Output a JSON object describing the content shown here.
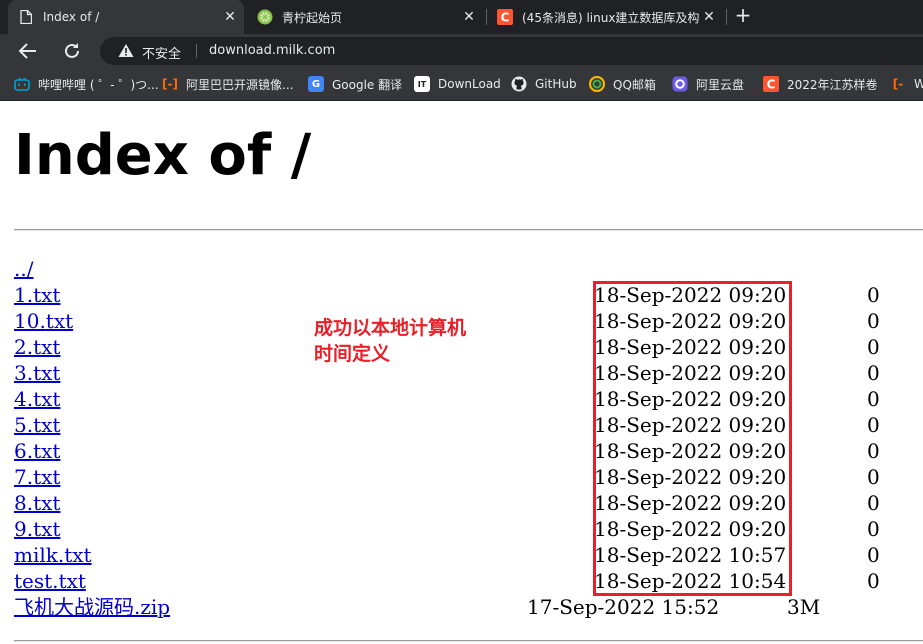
{
  "tabs": [
    {
      "title": "Index of /",
      "icon": "document-icon",
      "active": true
    },
    {
      "title": "青柠起始页",
      "icon": "lime-icon",
      "active": false
    },
    {
      "title": "(45条消息) linux建立数据库及构",
      "icon": "csdn-icon",
      "active": false
    }
  ],
  "toolbar": {
    "security_label": "不安全",
    "url": "download.milk.com"
  },
  "bookmarks": [
    {
      "label": "哔哩哔哩 ( ゜- ゜)つ...",
      "icon": "bilibili-icon",
      "color": "#00a1d6"
    },
    {
      "label": "阿里巴巴开源镜像...",
      "icon": "alibaba-icon",
      "color": "#ff6a00"
    },
    {
      "label": "Google 翻译",
      "icon": "google-translate-icon",
      "color": "#4285f4"
    },
    {
      "label": "DownLoad",
      "icon": "download-site-icon",
      "color": "#ffffff"
    },
    {
      "label": "GitHub",
      "icon": "github-icon",
      "color": "#ffffff"
    },
    {
      "label": "QQ邮箱",
      "icon": "qq-mail-icon",
      "color": "#f5b400"
    },
    {
      "label": "阿里云盘",
      "icon": "aliyun-drive-icon",
      "color": "#6c5ce7"
    },
    {
      "label": "2022年江苏样卷",
      "icon": "csdn-icon",
      "color": "#fc5531"
    },
    {
      "label": "W",
      "icon": "orange-bracket-icon",
      "color": "#ff6a00"
    }
  ],
  "page": {
    "title": "Index of /",
    "parent_link": "../",
    "entries": [
      {
        "name": "1.txt",
        "date": "18-Sep-2022 09:20",
        "size": "0"
      },
      {
        "name": "10.txt",
        "date": "18-Sep-2022 09:20",
        "size": "0"
      },
      {
        "name": "2.txt",
        "date": "18-Sep-2022 09:20",
        "size": "0"
      },
      {
        "name": "3.txt",
        "date": "18-Sep-2022 09:20",
        "size": "0"
      },
      {
        "name": "4.txt",
        "date": "18-Sep-2022 09:20",
        "size": "0"
      },
      {
        "name": "5.txt",
        "date": "18-Sep-2022 09:20",
        "size": "0"
      },
      {
        "name": "6.txt",
        "date": "18-Sep-2022 09:20",
        "size": "0"
      },
      {
        "name": "7.txt",
        "date": "18-Sep-2022 09:20",
        "size": "0"
      },
      {
        "name": "8.txt",
        "date": "18-Sep-2022 09:20",
        "size": "0"
      },
      {
        "name": "9.txt",
        "date": "18-Sep-2022 09:20",
        "size": "0"
      },
      {
        "name": "milk.txt",
        "date": "18-Sep-2022 10:57",
        "size": "0"
      },
      {
        "name": "test.txt",
        "date": "18-Sep-2022 10:54",
        "size": "0"
      },
      {
        "name": "飞机大战源码.zip",
        "date": "17-Sep-2022 15:52",
        "size": "3M"
      }
    ]
  },
  "annotation": {
    "line1": "成功以本地计算机",
    "line2": "时间定义",
    "color": "#e8202a"
  },
  "colors": {
    "link": "#0000cc",
    "chrome_dark": "#202124",
    "chrome_mid": "#35363a"
  }
}
